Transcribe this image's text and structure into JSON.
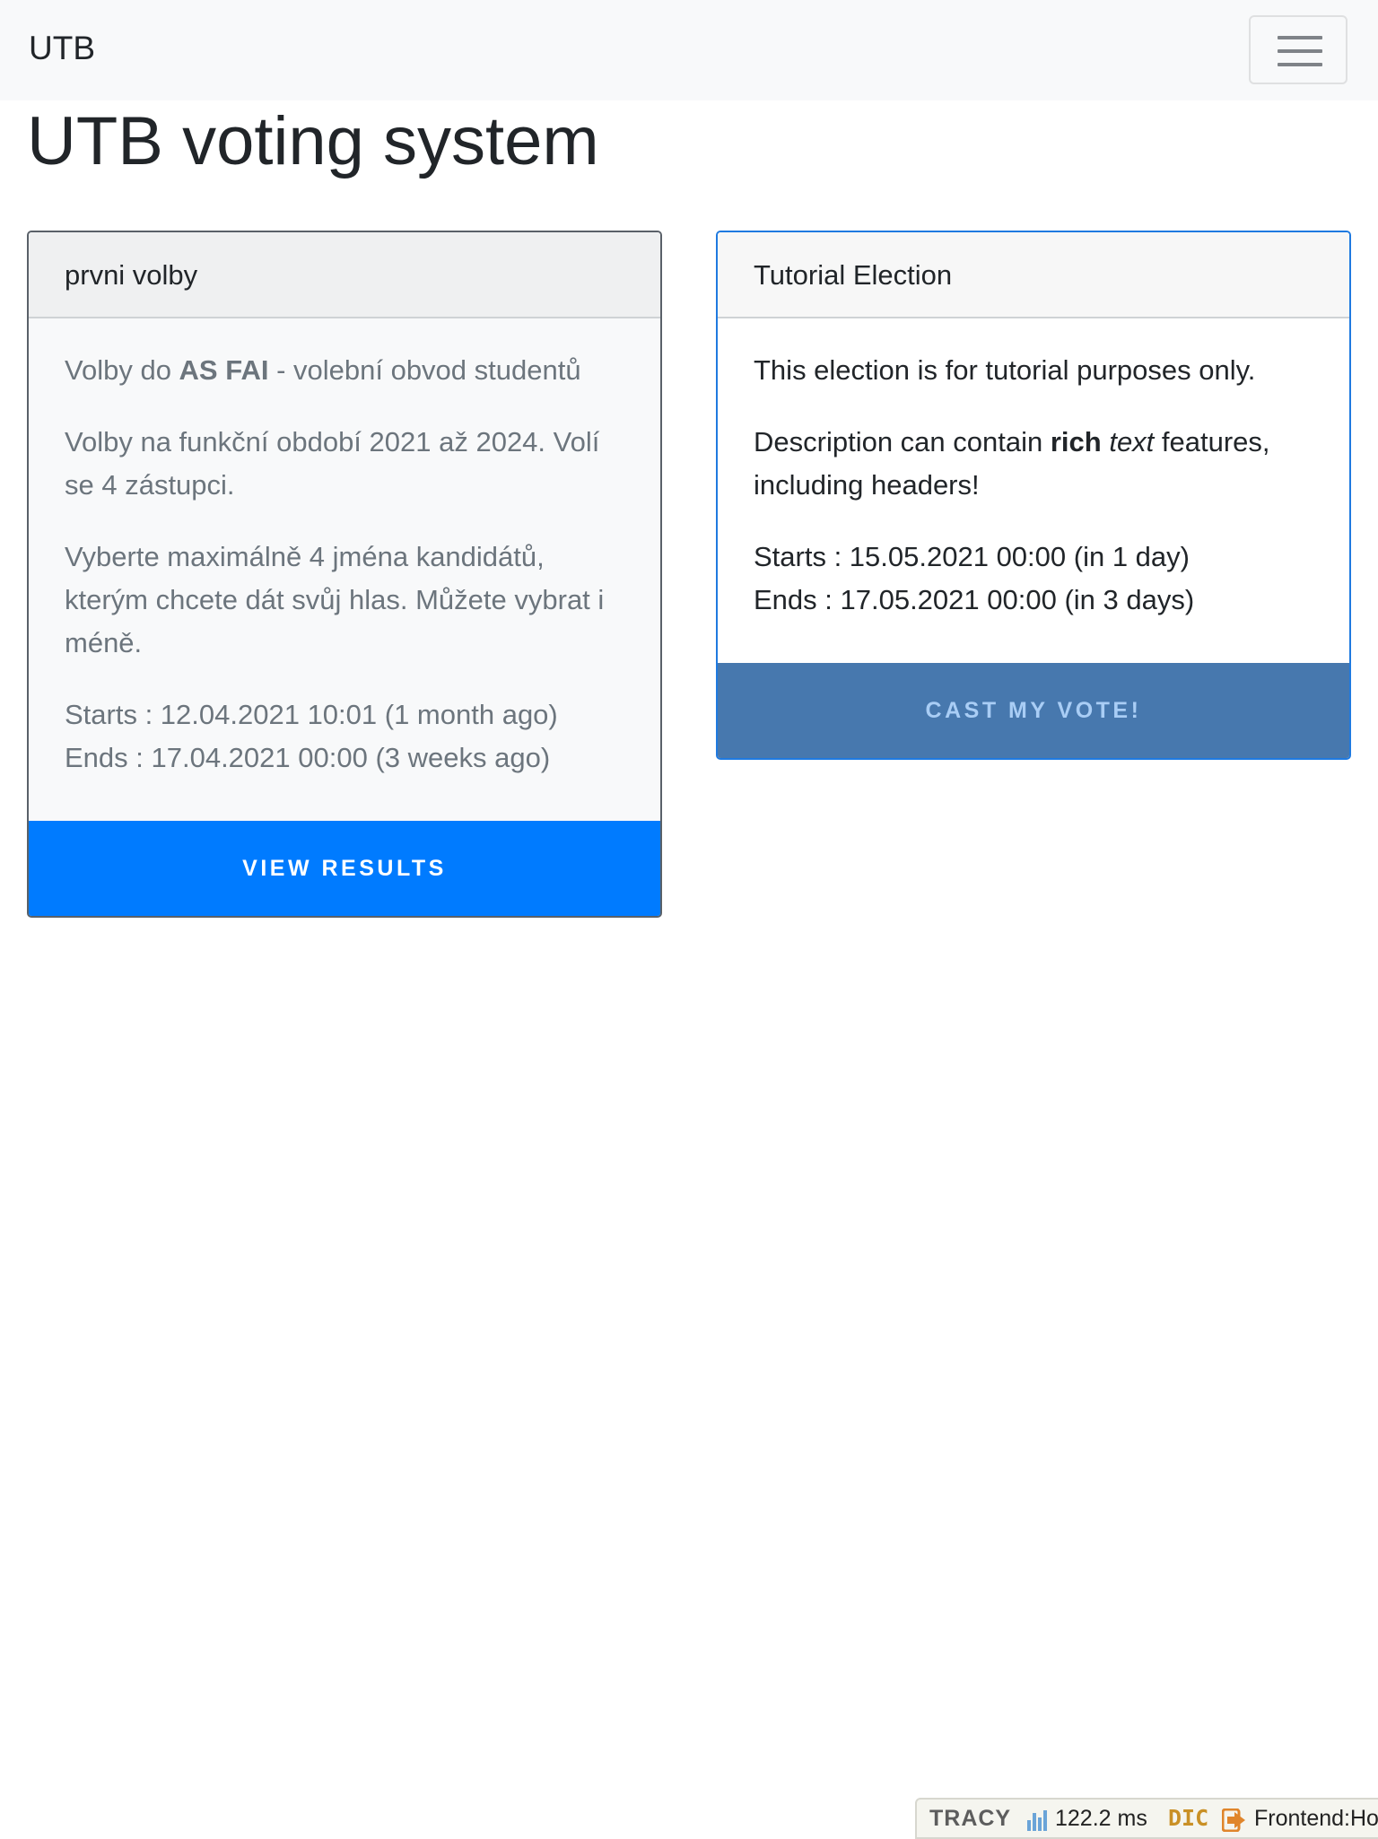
{
  "navbar": {
    "brand": "UTB"
  },
  "page_title": "UTB voting system",
  "elections": [
    {
      "title": "prvni volby",
      "desc1_before": "Volby do ",
      "desc1_bold": "AS FAI",
      "desc1_after": " - volební obvod studentů",
      "desc2": "Volby na funkční období 2021 až 2024. Volí se 4 zástupci.",
      "desc3": "Vyberte maximálně 4 jména kandidátů, kterým chcete dát svůj hlas. Můžete vybrat i méně.",
      "starts": "Starts : 12.04.2021 10:01 (1 month ago)",
      "ends": "Ends : 17.04.2021 00:00 (3 weeks ago)",
      "button": "VIEW RESULTS"
    },
    {
      "title": "Tutorial Election",
      "desc1": "This election is for tutorial purposes only.",
      "desc2_before": "Description can contain ",
      "desc2_bold": "rich",
      "desc2_space": " ",
      "desc2_italic": "text",
      "desc2_after": " features, including headers!",
      "starts": "Starts : 15.05.2021 00:00 (in 1 day)",
      "ends": "Ends : 17.05.2021 00:00 (in 3 days)",
      "button": "CAST MY VOTE!"
    }
  ],
  "tracy": {
    "logo": "TRACY",
    "time": "122.2 ms",
    "dic": "DIC",
    "route": "Frontend:Ho"
  },
  "colors": {
    "primary": "#007bff",
    "vote_button": "#4778ae",
    "vote_button_text": "#a9cdf5",
    "muted_text": "#6c757d",
    "navbar_bg": "#f8f9fa"
  }
}
